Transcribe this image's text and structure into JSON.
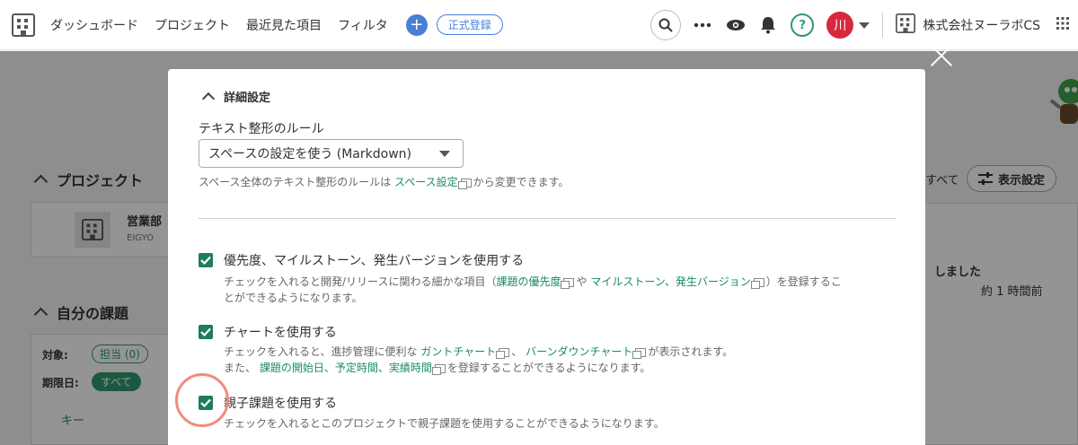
{
  "topbar": {
    "nav": [
      "ダッシュボード",
      "プロジェクト",
      "最近見た項目",
      "フィルタ"
    ],
    "add_label": "+",
    "register_label": "正式登録",
    "avatar_text": "川",
    "help_text": "?",
    "company": "株式会社ヌーラボCS"
  },
  "background": {
    "project_section": "プロジェクト",
    "project_name": "営業部",
    "project_key": "EIGYO",
    "my_issues_section": "自分の課題",
    "target_label": "対象:",
    "assignee_pill": "担当 (0)",
    "due_label": "期限日:",
    "all_pill": "すべて",
    "key_label": "キー",
    "all_text": "すべて",
    "display_settings": "表示設定",
    "activity_text": "しました",
    "activity_time": "約 1 時間前"
  },
  "modal": {
    "section_title": "詳細設定",
    "format_label": "テキスト整形のルール",
    "format_value": "スペースの設定を使う (Markdown)",
    "format_help_pre": "スペース全体のテキスト整形のルールは",
    "format_help_link": "スペース設定",
    "format_help_post": "から変更できます。",
    "options": [
      {
        "label": "優先度、マイルストーン、発生バージョンを使用する",
        "checked": true,
        "desc1_pre": "チェックを入れると開発/リリースに関わる細かな項目（",
        "link1": "課題の優先度",
        "desc1_mid": "や",
        "link2": "マイルストーン、発生バージョン",
        "desc1_post": "）を登録するこ",
        "desc2": "とができるようになります。"
      },
      {
        "label": "チャートを使用する",
        "checked": true,
        "desc1_pre": "チェックを入れると、進捗管理に便利な",
        "link1": "ガントチャート",
        "desc1_mid": "、",
        "link2": "バーンダウンチャート",
        "desc1_post": "が表示されます。",
        "desc2_pre": "また、",
        "link3": "課題の開始日、予定時間、実績時間",
        "desc2_post": "を登録することができるようになります。"
      },
      {
        "label": "親子課題を使用する",
        "checked": true,
        "desc1": "チェックを入れるとこのプロジェクトで親子課題を使用することができるようになります。"
      }
    ]
  },
  "colors": {
    "accent_green": "#1f7c5c",
    "link_green": "#1b8a67",
    "brand_blue": "#4a7fd6",
    "avatar_red": "#d8283c",
    "highlight": "#f28b7a"
  }
}
